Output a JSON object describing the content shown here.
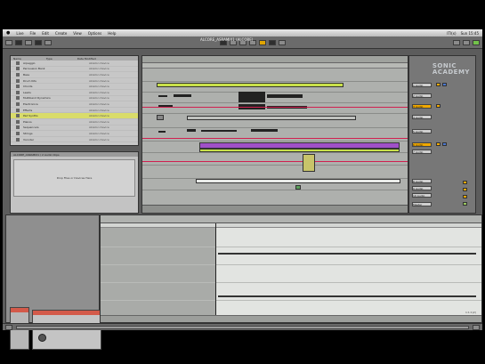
{
  "menubar": {
    "app_menu": "Live",
    "items": [
      "File",
      "Edit",
      "Create",
      "View",
      "Options",
      "Help"
    ],
    "right_items": [
      "ITI(x)",
      "Sun 15:45"
    ]
  },
  "toolbar": {
    "title": "ALCORE_ASRAMIX1 (ALCORE)"
  },
  "browser": {
    "columns": [
      "Name",
      "Type",
      "Date Modified"
    ],
    "items": [
      {
        "label": "Arpeggio",
        "kind": "Ableton Device"
      },
      {
        "label": "Percussion Bank",
        "kind": "Ableton Device"
      },
      {
        "label": "Bass",
        "kind": "Ableton Device"
      },
      {
        "label": "Drum Kits",
        "kind": "Ableton Device"
      },
      {
        "label": "Chords",
        "kind": "Ableton Device"
      },
      {
        "label": "Leads",
        "kind": "Ableton Device"
      },
      {
        "label": "Multiband Dynamics",
        "kind": "Ableton Device"
      },
      {
        "label": "Electronica",
        "kind": "Ableton Device"
      },
      {
        "label": "Effects",
        "kind": "Ableton Device"
      },
      {
        "label": "Pad Synths",
        "kind": "Ableton Device"
      },
      {
        "label": "Pianos",
        "kind": "Ableton Device"
      },
      {
        "label": "Sequencers",
        "kind": "Ableton Device"
      },
      {
        "label": "Strings",
        "kind": "Ableton Device"
      },
      {
        "label": "Vocoder",
        "kind": "Ableton Device"
      }
    ]
  },
  "info": {
    "header": "ALCORE_ASRAMIX1 / 2 Audio Clips",
    "drop_hint": "Drop Files or Devices Here"
  },
  "mixer": {
    "tracks": [
      "1 Audio",
      "2 Audio",
      "3 Audio",
      "4 Audio",
      "5 Audio",
      "6 Audio",
      "7 Audio",
      "8 Audio",
      "9 Audio",
      "10 Audio"
    ],
    "master": "Master"
  },
  "logo": [
    "SONIC",
    "ACADEMY"
  ],
  "clipview": {
    "stamp": "1:1:1(2)"
  },
  "colors": {
    "clip_yellow": "#c8e04a",
    "clip_purple": "#a050c8",
    "track_orange": "#f0a800",
    "automation_red": "#d02050"
  }
}
